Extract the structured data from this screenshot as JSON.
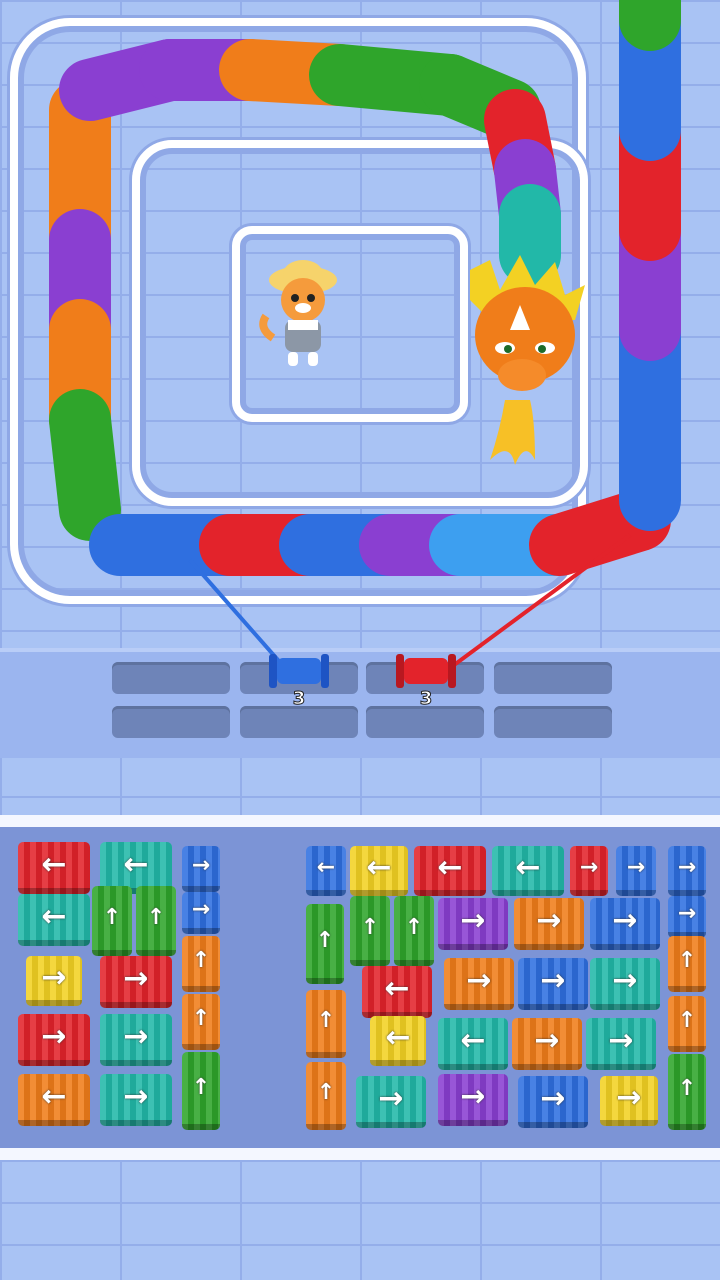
{
  "game": {
    "level_scene": "knit dragon",
    "colors": {
      "red": "#e3232b",
      "orange": "#f07d1a",
      "green": "#2fa52b",
      "teal": "#22b8a8",
      "blue": "#2f6fe0",
      "purple": "#8a3fd1",
      "yellow": "#f3d123",
      "sky": "#3d9ff0"
    }
  },
  "slots": {
    "spools": [
      {
        "color": "blue",
        "count": "3"
      },
      {
        "color": "red",
        "count": "3"
      }
    ]
  },
  "icons": {
    "left": "←",
    "right": "→",
    "up": "↑"
  }
}
